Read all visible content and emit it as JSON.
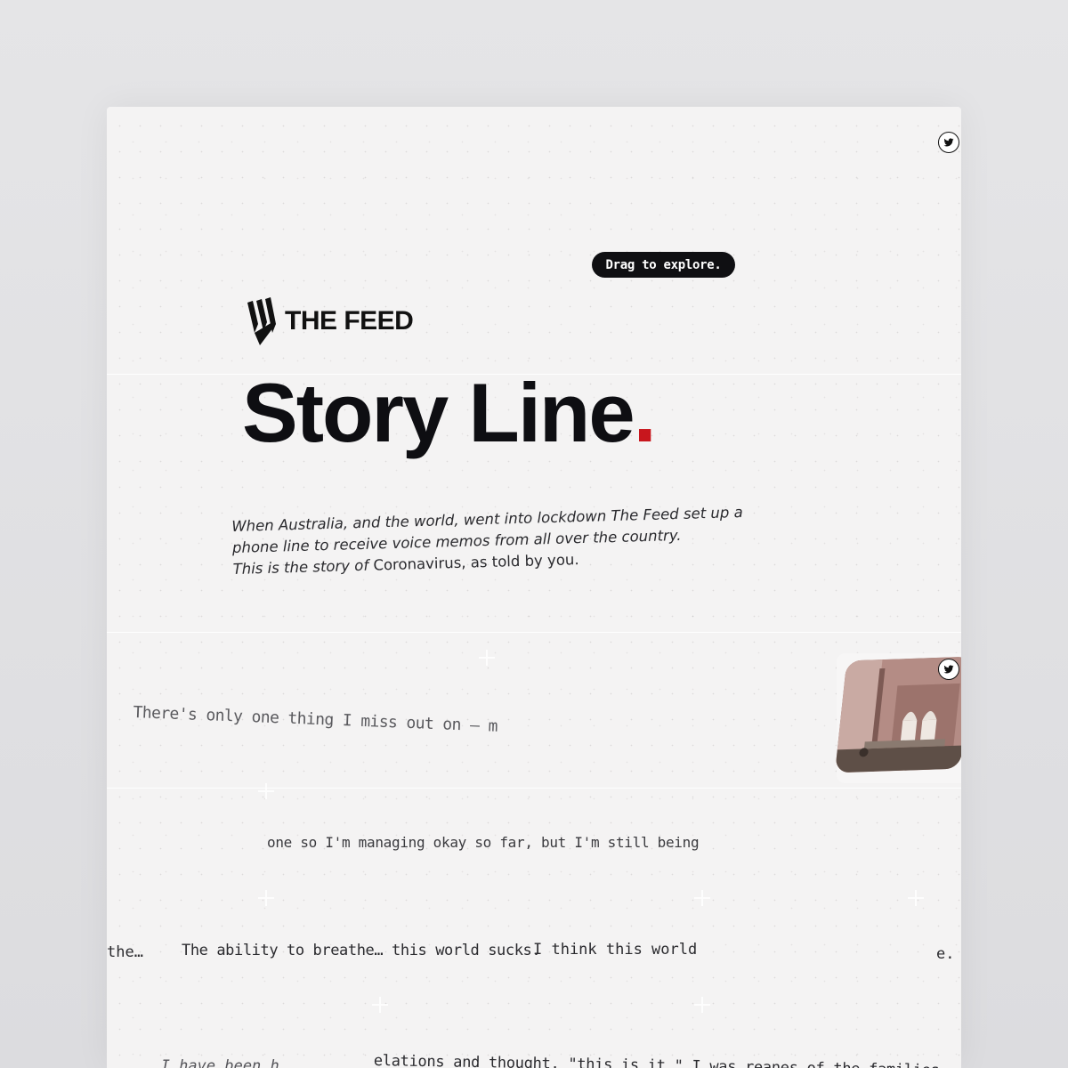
{
  "social": {
    "share_icon_top": "twitter-icon",
    "share_icon_photo": "twitter-icon"
  },
  "hint": {
    "drag_label": "Drag to explore."
  },
  "brand": {
    "name": "THE FEED",
    "logo_icon": "sbs-logo-icon"
  },
  "headline": {
    "text": "Story Line",
    "dot": ".",
    "dot_color": "#c8161d"
  },
  "intro": {
    "line1": "When Australia, and the world, went into lockdown The Feed set up a",
    "line2": "phone line to receive voice memos from all over the country.",
    "line3_italic": "This is the story of",
    "line3_rest": " Coronavirus, as told by you."
  },
  "quotes": {
    "q1": "There's only one thing I miss out on – m",
    "q2": "one so I'm managing okay so far, but I'm still being car",
    "q3a": "the…",
    "q3b": "The ability to breathe… this world sucks.",
    "q3c": "I think this world sucl",
    "q3d": "e.",
    "q4a": "...I have been h",
    "q4b": "elations and thought, \"this is it,\" I was reanes of the families"
  }
}
